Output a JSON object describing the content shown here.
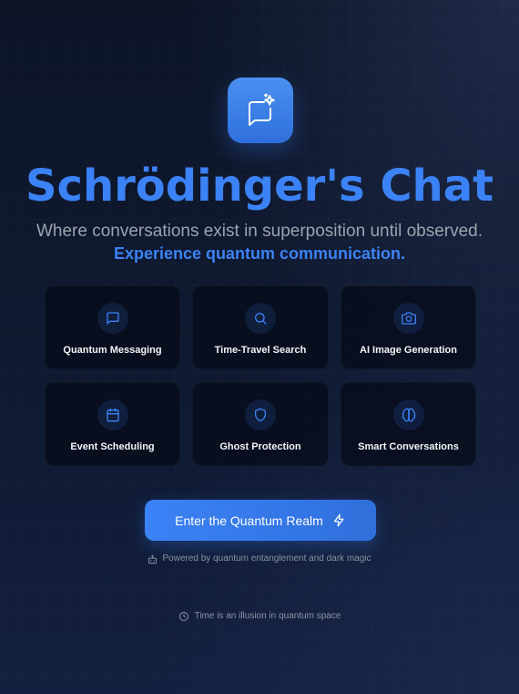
{
  "app": {
    "title": "Schrödinger's Chat",
    "subtitle": "Where conversations exist in superposition until observed.",
    "tagline": "Experience quantum communication.",
    "logo_icon": "chat-sparkle-icon"
  },
  "features": [
    {
      "label": "Quantum Messaging",
      "icon": "message-square-icon"
    },
    {
      "label": "Time-Travel Search",
      "icon": "search-icon"
    },
    {
      "label": "AI Image Generation",
      "icon": "camera-icon"
    },
    {
      "label": "Event Scheduling",
      "icon": "calendar-icon"
    },
    {
      "label": "Ghost Protection",
      "icon": "shield-icon"
    },
    {
      "label": "Smart Conversations",
      "icon": "brain-icon"
    }
  ],
  "cta": {
    "label": "Enter the Quantum Realm",
    "icon": "lightning-icon"
  },
  "powered_by": {
    "text": "Powered by quantum entanglement and dark magic",
    "icon": "robot-icon"
  },
  "footer": {
    "text": "Time is an illusion in quantum space",
    "icon": "clock-icon"
  },
  "colors": {
    "accent": "#3b82f6",
    "background": "#0f1a33",
    "card": "#070b16",
    "muted_text": "#9ca3af"
  }
}
